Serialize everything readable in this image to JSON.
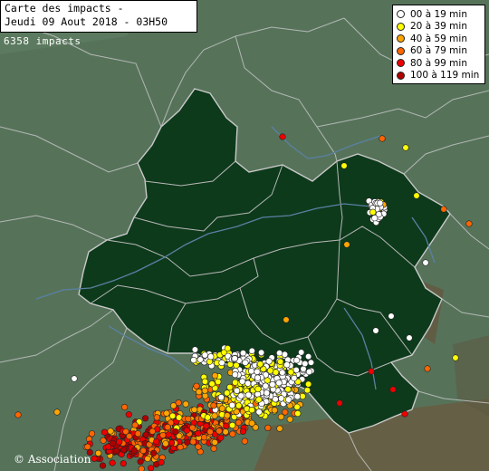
{
  "title": {
    "line1": "Carte des impacts -",
    "line2": "Jeudi 09 Aout 2018 - 03H50"
  },
  "impacts_count": "6358 impacts",
  "legend": [
    {
      "label": "00 à 19 min",
      "color": "#ffffff"
    },
    {
      "label": "20 à 39 min",
      "color": "#ffff00"
    },
    {
      "label": "40 à 59 min",
      "color": "#ffa500"
    },
    {
      "label": "60 à 79 min",
      "color": "#ff6600"
    },
    {
      "label": "80 à 99 min",
      "color": "#ee0000"
    },
    {
      "label": "100 à 119 min",
      "color": "#b00000"
    }
  ],
  "copyright": "© Association",
  "colors": {
    "land": "#56735a",
    "region_fill": "#0e3a1c",
    "relief": "#7a5a3a",
    "borders": "#c7c7c7",
    "rivers": "#5a7fa0"
  }
}
